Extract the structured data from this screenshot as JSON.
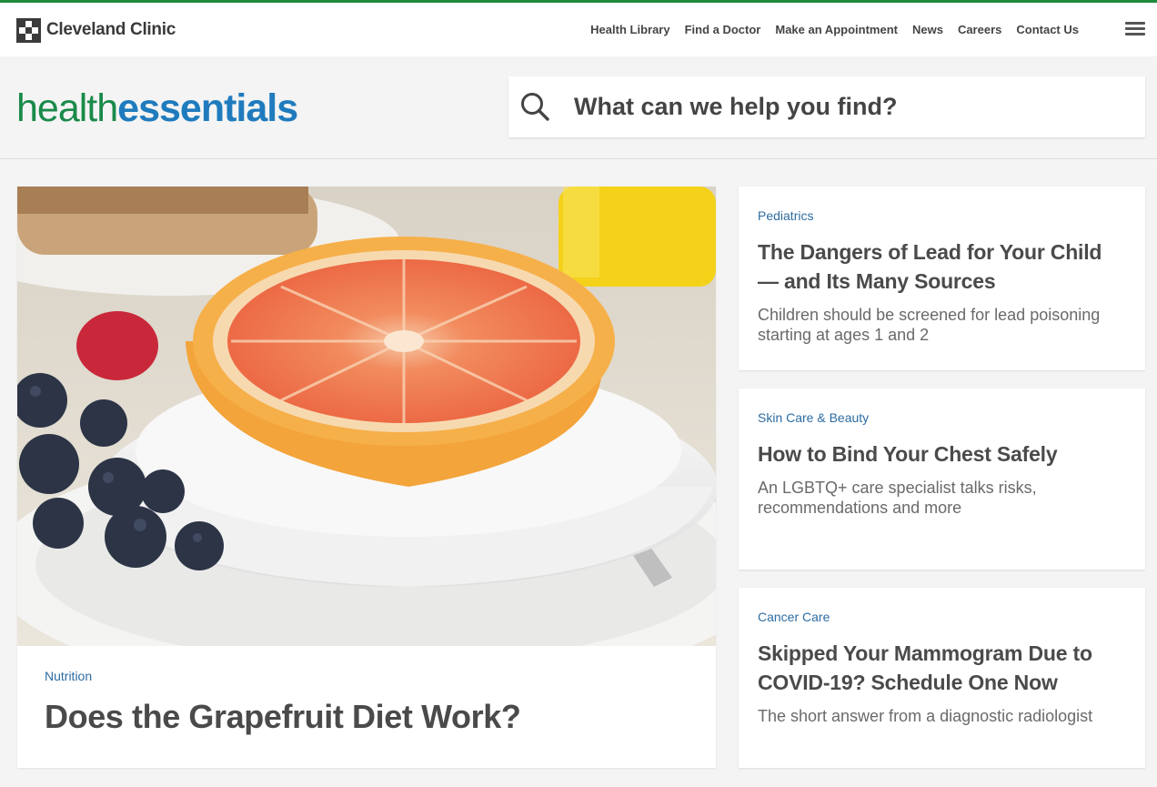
{
  "brand": {
    "name": "Cleveland Clinic"
  },
  "nav": [
    {
      "label": "Health Library"
    },
    {
      "label": "Find a Doctor"
    },
    {
      "label": "Make an Appointment"
    },
    {
      "label": "News"
    },
    {
      "label": "Careers"
    },
    {
      "label": "Contact Us"
    }
  ],
  "site_logo": {
    "part1": "health",
    "part2": "essentials"
  },
  "search": {
    "placeholder": "What can we help you find?"
  },
  "hero": {
    "category": "Nutrition",
    "title": "Does the Grapefruit Diet Work?"
  },
  "cards": [
    {
      "category": "Pediatrics",
      "title": "The Dangers of Lead for Your Child — and Its Many Sources",
      "description": "Children should be screened for lead poisoning starting at ages 1 and 2"
    },
    {
      "category": "Skin Care & Beauty",
      "title": "How to Bind Your Chest Safely",
      "description": "An LGBTQ+ care specialist talks risks, recommendations and more"
    },
    {
      "category": "Cancer Care",
      "title": "Skipped Your Mammogram Due to COVID-19? Schedule One Now",
      "description": "The short answer from a diagnostic radiologist"
    }
  ],
  "colors": {
    "brand_green": "#1e8a3c",
    "logo_green": "#1a8a4a",
    "logo_blue": "#1f7bbd",
    "category_blue": "#2d6ca2"
  }
}
